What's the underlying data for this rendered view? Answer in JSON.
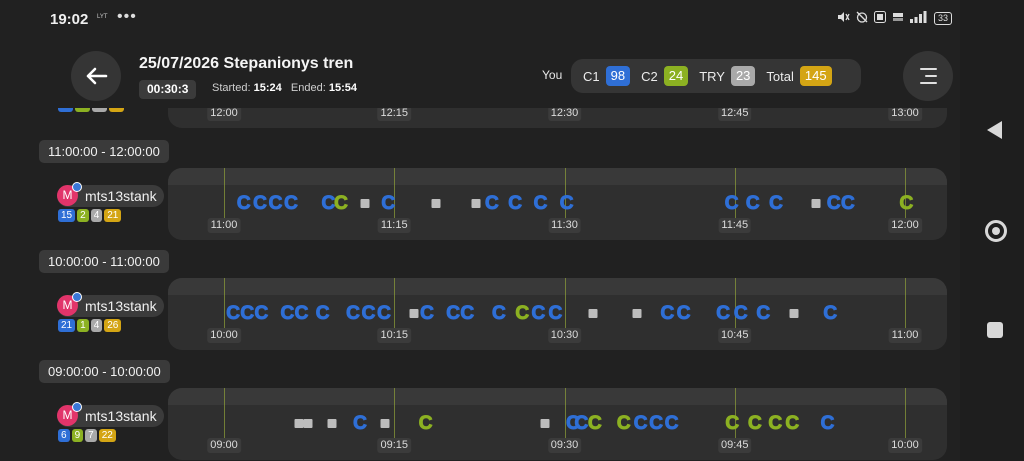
{
  "colors": {
    "c1": "#2f6fd6",
    "c2": "#8cb122",
    "try": "#a9a9a9",
    "total": "#d4a514",
    "marker": "#bdbdbd"
  },
  "status": {
    "time": "19:02",
    "carrier": "LYT",
    "dots": "•••",
    "icons": [
      "mute-icon",
      "alarm-off-icon",
      "volte-icon",
      "5g-icon",
      "signal-icon"
    ],
    "battery": "33"
  },
  "header": {
    "title": "25/07/2026 Stepanionys tren",
    "duration": "00:30:3",
    "started_label": "Started:",
    "started": "15:24",
    "ended_label": "Ended:",
    "ended": "15:54"
  },
  "stats": {
    "you_label": "You",
    "c1_label": "C1",
    "c1": "98",
    "c2_label": "C2",
    "c2": "24",
    "try_label": "TRY",
    "try": "23",
    "total_label": "Total",
    "total": "145"
  },
  "sections": [
    {
      "label": null,
      "ticks": [
        "12:00",
        "12:15",
        "12:30",
        "12:45",
        "13:00"
      ],
      "events": []
    },
    {
      "label": "11:00:00 - 12:00:00",
      "user": {
        "initial": "M",
        "name": "mts13stank",
        "c1": "15",
        "c2": "2",
        "try": "4",
        "total": "21"
      },
      "ticks": [
        "11:00",
        "11:15",
        "11:30",
        "11:45",
        "12:00"
      ],
      "events": [
        [
          0.045,
          "c1"
        ],
        [
          0.068,
          "c1"
        ],
        [
          0.09,
          "c1"
        ],
        [
          0.112,
          "c1"
        ],
        [
          0.165,
          "c1"
        ],
        [
          0.183,
          "c2"
        ],
        [
          0.217,
          "try"
        ],
        [
          0.25,
          "c1"
        ],
        [
          0.318,
          "try"
        ],
        [
          0.374,
          "try"
        ],
        [
          0.397,
          "c1"
        ],
        [
          0.43,
          "c1"
        ],
        [
          0.466,
          "c1"
        ],
        [
          0.503,
          "c1"
        ],
        [
          0.737,
          "c1"
        ],
        [
          0.767,
          "c1"
        ],
        [
          0.8,
          "c1"
        ],
        [
          0.857,
          "try"
        ],
        [
          0.882,
          "c1"
        ],
        [
          0.902,
          "c1"
        ],
        [
          0.985,
          "c2"
        ]
      ]
    },
    {
      "label": "10:00:00 - 11:00:00",
      "user": {
        "initial": "M",
        "name": "mts13stank",
        "c1": "21",
        "c2": "1",
        "try": "4",
        "total": "26"
      },
      "ticks": [
        "10:00",
        "10:15",
        "10:30",
        "10:45",
        "11:00"
      ],
      "events": [
        [
          0.03,
          "c1"
        ],
        [
          0.05,
          "c1"
        ],
        [
          0.07,
          "c1"
        ],
        [
          0.107,
          "c1"
        ],
        [
          0.127,
          "c1"
        ],
        [
          0.157,
          "c1"
        ],
        [
          0.2,
          "c1"
        ],
        [
          0.222,
          "c1"
        ],
        [
          0.244,
          "c1"
        ],
        [
          0.286,
          "try"
        ],
        [
          0.305,
          "c1"
        ],
        [
          0.342,
          "c1"
        ],
        [
          0.362,
          "c1"
        ],
        [
          0.407,
          "c1"
        ],
        [
          0.44,
          "c2"
        ],
        [
          0.463,
          "c1"
        ],
        [
          0.487,
          "c1"
        ],
        [
          0.54,
          "try"
        ],
        [
          0.603,
          "try"
        ],
        [
          0.646,
          "c1"
        ],
        [
          0.669,
          "c1"
        ],
        [
          0.725,
          "c1"
        ],
        [
          0.75,
          "c1"
        ],
        [
          0.782,
          "c1"
        ],
        [
          0.825,
          "try"
        ],
        [
          0.877,
          "c1"
        ]
      ]
    },
    {
      "label": "09:00:00 - 10:00:00",
      "user": {
        "initial": "M",
        "name": "mts13stank",
        "c1": "6",
        "c2": "9",
        "try": "7",
        "total": "22"
      },
      "ticks": [
        "09:00",
        "09:15",
        "09:30",
        "09:45",
        "10:00"
      ],
      "events": [
        [
          0.123,
          "try"
        ],
        [
          0.136,
          "try"
        ],
        [
          0.17,
          "try"
        ],
        [
          0.21,
          "c1"
        ],
        [
          0.245,
          "try"
        ],
        [
          0.303,
          "c2"
        ],
        [
          0.473,
          "try"
        ],
        [
          0.512,
          "c1"
        ],
        [
          0.524,
          "c1"
        ],
        [
          0.543,
          "c2"
        ],
        [
          0.584,
          "c2"
        ],
        [
          0.608,
          "c1"
        ],
        [
          0.63,
          "c1"
        ],
        [
          0.652,
          "c1"
        ],
        [
          0.738,
          "c2"
        ],
        [
          0.77,
          "c2"
        ],
        [
          0.799,
          "c2"
        ],
        [
          0.823,
          "c2"
        ],
        [
          0.873,
          "c1"
        ]
      ]
    }
  ]
}
